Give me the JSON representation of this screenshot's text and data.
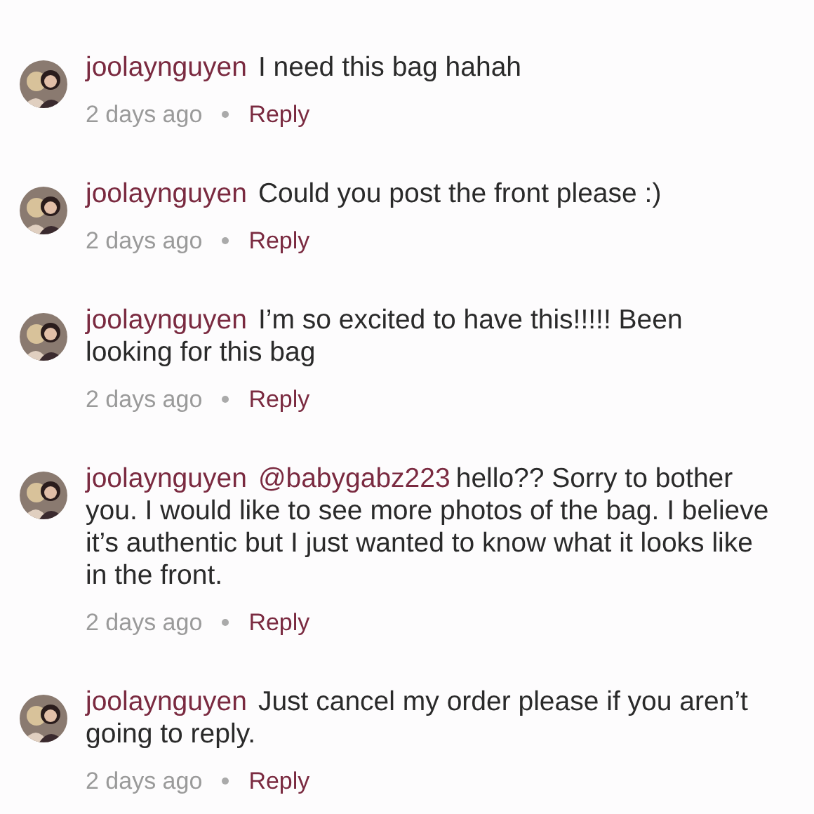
{
  "comments": [
    {
      "user": "joolaynguyen",
      "text": "I need this bag hahah",
      "time": "2 days ago",
      "reply": "Reply"
    },
    {
      "user": "joolaynguyen",
      "text": "Could you post the front please :)",
      "time": "2 days ago",
      "reply": "Reply"
    },
    {
      "user": "joolaynguyen",
      "text": "I’m so excited to have this!!!!! Been looking for this bag",
      "time": "2 days ago",
      "reply": "Reply"
    },
    {
      "user": "joolaynguyen",
      "mention": "@babygabz223",
      "text": "hello?? Sorry to bother you. I would like to see more photos of the bag. I believe it’s authentic but I just wanted to know what it looks like in the front.",
      "time": "2 days ago",
      "reply": "Reply"
    },
    {
      "user": "joolaynguyen",
      "text": "Just cancel my order please if you aren’t going to reply.",
      "time": "2 days ago",
      "reply": "Reply"
    }
  ]
}
